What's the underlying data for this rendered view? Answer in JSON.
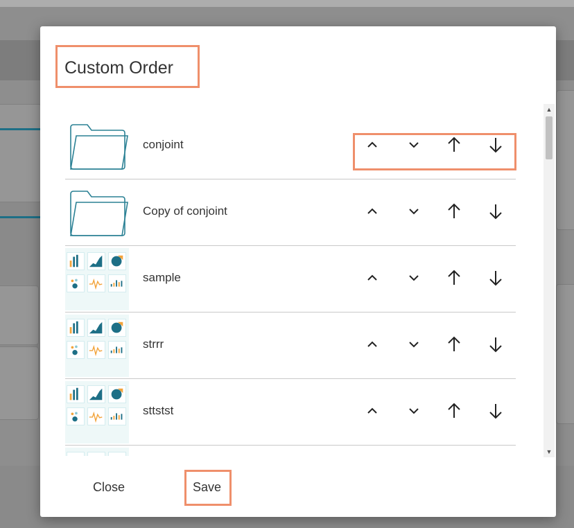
{
  "dialog": {
    "title": "Custom Order",
    "close_label": "Close",
    "save_label": "Save"
  },
  "items": [
    {
      "name": "conjoint",
      "icon": "folder-icon"
    },
    {
      "name": "Copy of conjoint",
      "icon": "folder-icon"
    },
    {
      "name": "sample",
      "icon": "dashboard-icon"
    },
    {
      "name": "strrr",
      "icon": "dashboard-icon"
    },
    {
      "name": "sttstst",
      "icon": "dashboard-icon"
    }
  ],
  "controls": [
    "move-up-icon",
    "move-down-icon",
    "move-to-top-icon",
    "move-to-bottom-icon"
  ],
  "colors": {
    "highlight": "#ef8f6b",
    "folder_stroke": "#2a8094",
    "chart_teal": "#1d6f86",
    "chart_orange": "#f2a33a"
  }
}
